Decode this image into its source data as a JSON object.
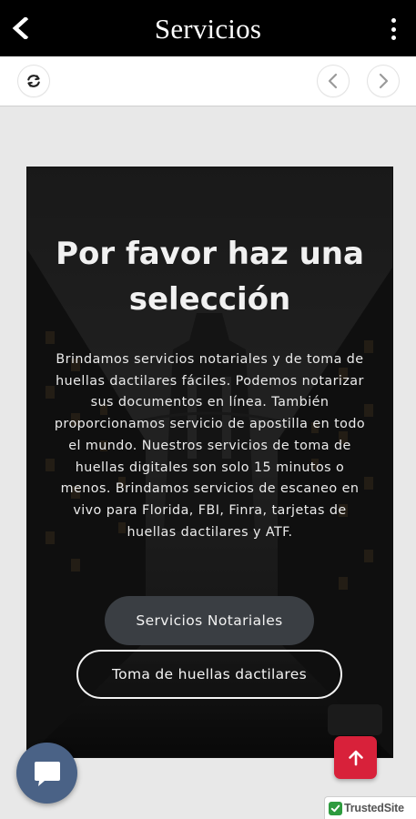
{
  "header": {
    "title": "Servicios",
    "back_icon": "back-arrow-icon",
    "menu_icon": "more-vertical-icon"
  },
  "toolbar": {
    "refresh_icon": "refresh-icon",
    "prev_icon": "chevron-left-icon",
    "next_icon": "chevron-right-icon"
  },
  "hero": {
    "title": "Por favor haz una selección",
    "body": "Brindamos servicios notariales y de toma de huellas dactilares fáciles. Podemos notarizar sus documentos en línea. También proporcionamos servicio de apostilla en todo el mundo. Nuestros servicios de toma de huellas digitales son solo 15 minutos o menos. Brindamos servicios de escaneo en vivo para Florida, FBI, Finra, tarjetas de huellas dactilares y ATF.",
    "button_primary": "Servicios Notariales",
    "button_secondary": "Toma de huellas dactilares"
  },
  "floating": {
    "chat_icon": "chat-bubble-icon",
    "scroll_top_icon": "arrow-up-icon",
    "trusted_badge": "TrustedSite"
  },
  "colors": {
    "header_bg": "#000000",
    "page_bg": "#e8e8e8",
    "chat_fab": "#4a6286",
    "scroll_top_fab": "#d8213a",
    "primary_button": "#3a3e43",
    "trusted_green": "#2e9b3e"
  }
}
